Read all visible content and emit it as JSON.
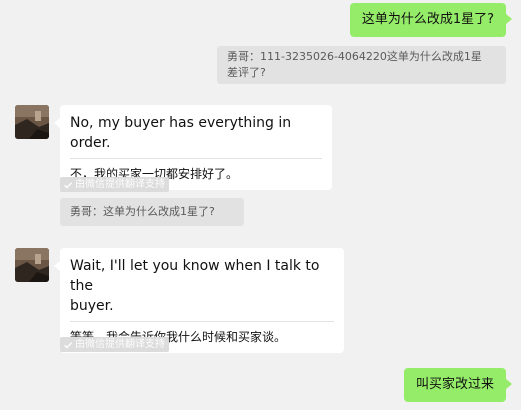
{
  "messages": {
    "m1": {
      "text": "这单为什么改成1星了?"
    },
    "q1": {
      "line1": "勇哥：111-3235026-4064220这单为什么改成1星",
      "line2": "差评了?"
    },
    "m2": {
      "original": "No, my buyer has everything in order.",
      "translation": "不，我的买家一切都安排好了。",
      "badge": "由微信提供翻译支持"
    },
    "q2": {
      "text": "勇哥：这单为什么改成1星了?"
    },
    "m3": {
      "original_line1": "Wait, I'll let you know when I talk to the",
      "original_line2": "buyer.",
      "translation": "等等，我会告诉你我什么时候和买家谈。",
      "badge": "由微信提供翻译支持"
    },
    "m4": {
      "text": "叫买家改过来"
    }
  },
  "colors": {
    "outgoing_bubble": "#95ec69",
    "incoming_bubble": "#ffffff",
    "quote_background": "#e2e2e2",
    "chat_background": "#f1f1f1"
  },
  "icons": {
    "badge": "check-icon",
    "avatar": "contact-avatar-image"
  }
}
